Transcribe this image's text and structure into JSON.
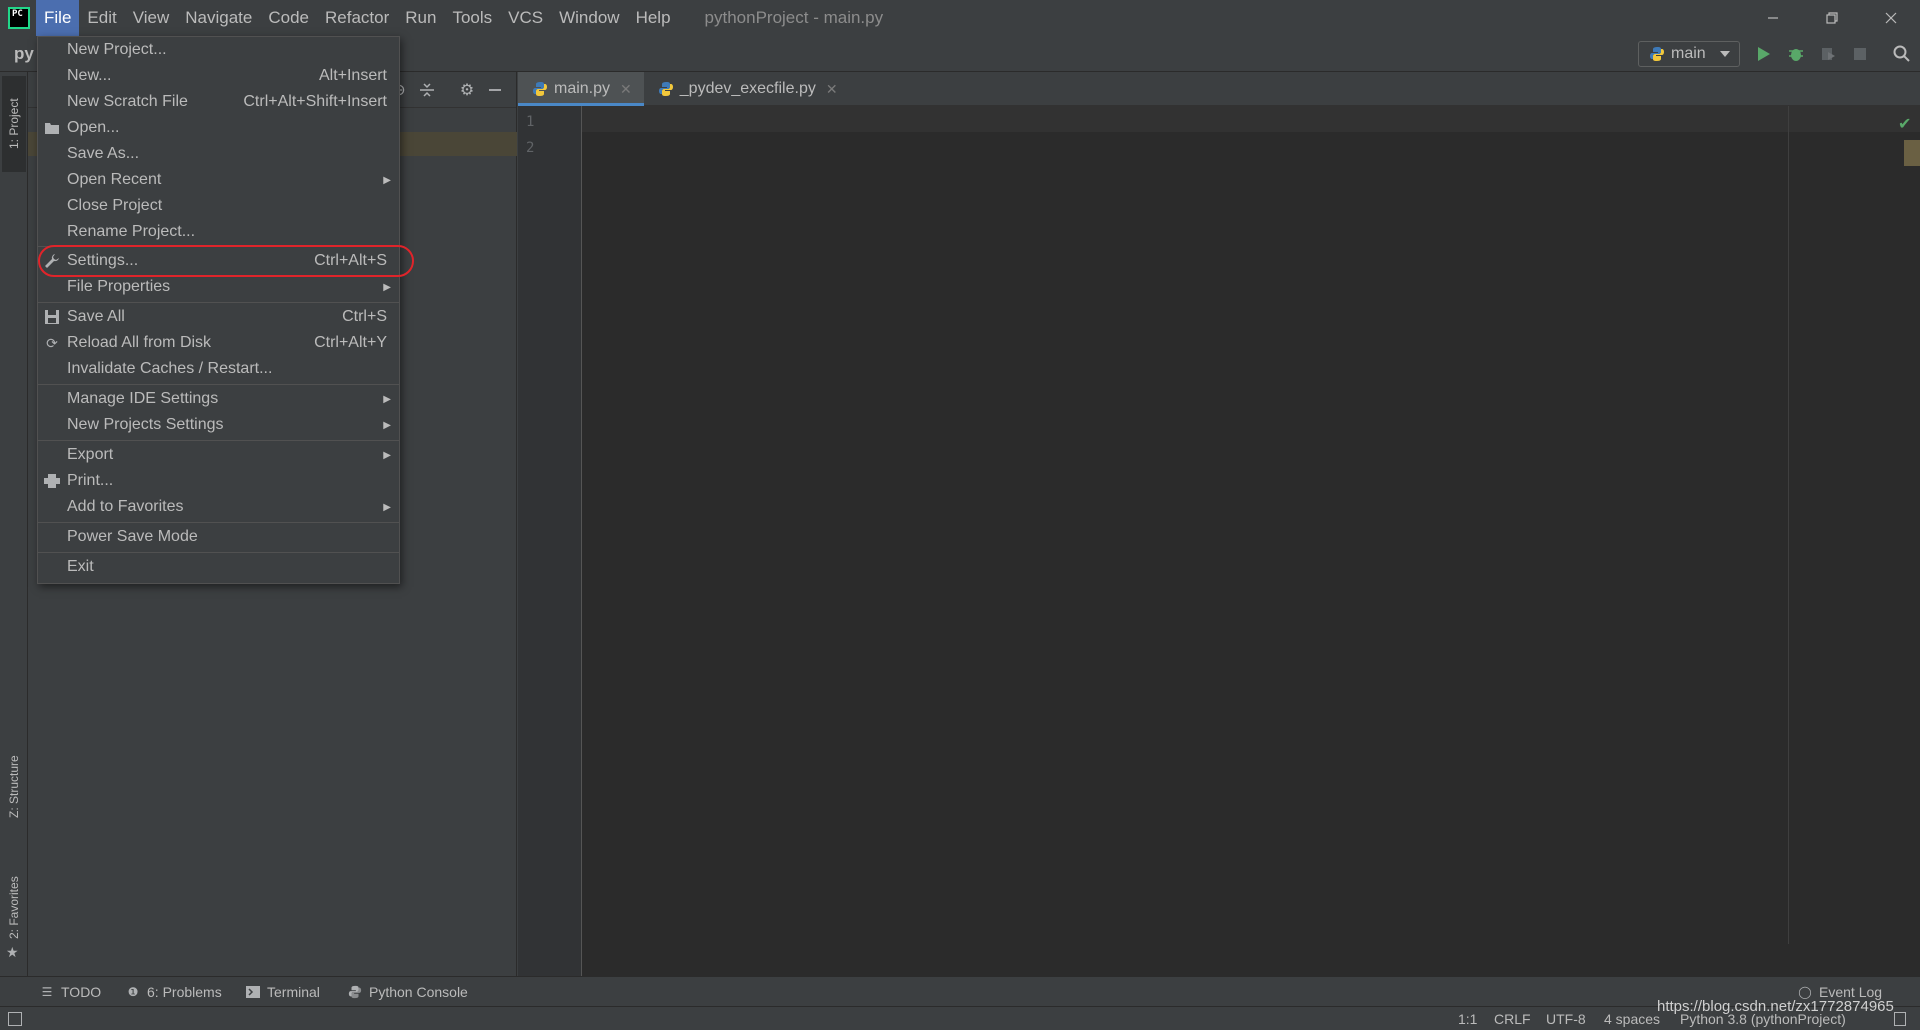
{
  "app": {
    "logo_text": "PC",
    "window_title": "pythonProject - main.py"
  },
  "menubar": [
    {
      "label": "File",
      "active": true
    },
    {
      "label": "Edit"
    },
    {
      "label": "View"
    },
    {
      "label": "Navigate"
    },
    {
      "label": "Code"
    },
    {
      "label": "Refactor"
    },
    {
      "label": "Run"
    },
    {
      "label": "Tools"
    },
    {
      "label": "VCS"
    },
    {
      "label": "Window"
    },
    {
      "label": "Help"
    }
  ],
  "toolbar": {
    "project_crumb": "py",
    "run_config": "main"
  },
  "file_menu": {
    "items": [
      {
        "label": "New Project...",
        "shortcut": ""
      },
      {
        "label": "New...",
        "shortcut": "Alt+Insert"
      },
      {
        "label": "New Scratch File",
        "shortcut": "Ctrl+Alt+Shift+Insert"
      },
      {
        "label": "Open...",
        "shortcut": "",
        "icon": "folder-open-icon"
      },
      {
        "label": "Save As...",
        "shortcut": ""
      },
      {
        "label": "Open Recent",
        "shortcut": "",
        "submenu": true
      },
      {
        "label": "Close Project",
        "shortcut": ""
      },
      {
        "label": "Rename Project...",
        "shortcut": ""
      },
      {
        "label": "Settings...",
        "shortcut": "Ctrl+Alt+S",
        "icon": "wrench-icon",
        "highlighted": true
      },
      {
        "label": "File Properties",
        "shortcut": "",
        "submenu": true
      },
      {
        "label": "Save All",
        "shortcut": "Ctrl+S",
        "icon": "save-icon"
      },
      {
        "label": "Reload All from Disk",
        "shortcut": "Ctrl+Alt+Y",
        "icon": "reload-icon"
      },
      {
        "label": "Invalidate Caches / Restart...",
        "shortcut": ""
      },
      {
        "label": "Manage IDE Settings",
        "shortcut": "",
        "submenu": true
      },
      {
        "label": "New Projects Settings",
        "shortcut": "",
        "submenu": true
      },
      {
        "label": "Export",
        "shortcut": "",
        "submenu": true
      },
      {
        "label": "Print...",
        "shortcut": "",
        "icon": "print-icon"
      },
      {
        "label": "Add to Favorites",
        "shortcut": "",
        "submenu": true
      },
      {
        "label": "Power Save Mode",
        "shortcut": ""
      },
      {
        "label": "Exit",
        "shortcut": ""
      }
    ]
  },
  "left_stripe": {
    "project_tab": "1: Project",
    "structure_tab": "Z: Structure",
    "favorites_tab": "2: Favorites"
  },
  "editor": {
    "tabs": [
      {
        "label": "main.py",
        "active": true
      },
      {
        "label": "_pydev_execfile.py",
        "active": false
      }
    ],
    "line_numbers": [
      "1",
      "2"
    ]
  },
  "bottom_tools": [
    {
      "label": "TODO",
      "icon": "list-icon"
    },
    {
      "label": "6: Problems",
      "icon": "info-icon"
    },
    {
      "label": "Terminal",
      "icon": "terminal-icon"
    },
    {
      "label": "Python Console",
      "icon": "python-icon"
    }
  ],
  "event_log": "Event Log",
  "status": {
    "position": "1:1",
    "line_sep": "CRLF",
    "encoding": "UTF-8",
    "indent": "4 spaces",
    "interpreter": "Python 3.8 (pythonProject)"
  },
  "watermark": "https://blog.csdn.net/zx1772874965",
  "colors": {
    "accent": "#4b6eaf",
    "highlight_circle": "#e0242a",
    "run_green": "#59a869"
  }
}
